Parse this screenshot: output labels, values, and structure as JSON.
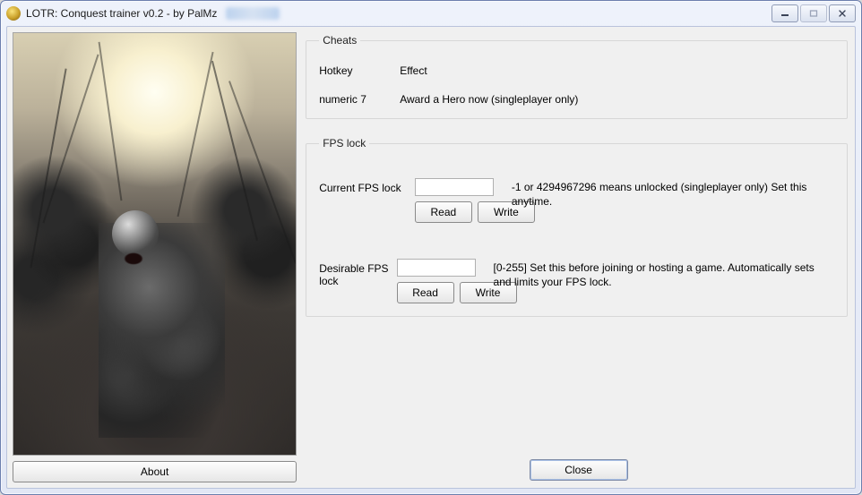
{
  "window": {
    "title": "LOTR: Conquest trainer v0.2 - by PalMz"
  },
  "left": {
    "about_label": "About"
  },
  "cheats": {
    "legend": "Cheats",
    "header_hotkey": "Hotkey",
    "header_effect": "Effect",
    "rows": [
      {
        "hotkey": "numeric 7",
        "effect": "Award a Hero now (singleplayer only)"
      }
    ]
  },
  "fps": {
    "legend": "FPS lock",
    "current": {
      "label": "Current FPS lock",
      "value": "",
      "read_label": "Read",
      "write_label": "Write",
      "desc": "-1 or 4294967296 means unlocked (singleplayer only) Set this anytime."
    },
    "desirable": {
      "label": "Desirable FPS lock",
      "value": "",
      "read_label": "Read",
      "write_label": "Write",
      "desc": "[0-255] Set this before joining or hosting a game. Automatically sets and limits your FPS lock."
    }
  },
  "footer": {
    "close_label": "Close"
  }
}
